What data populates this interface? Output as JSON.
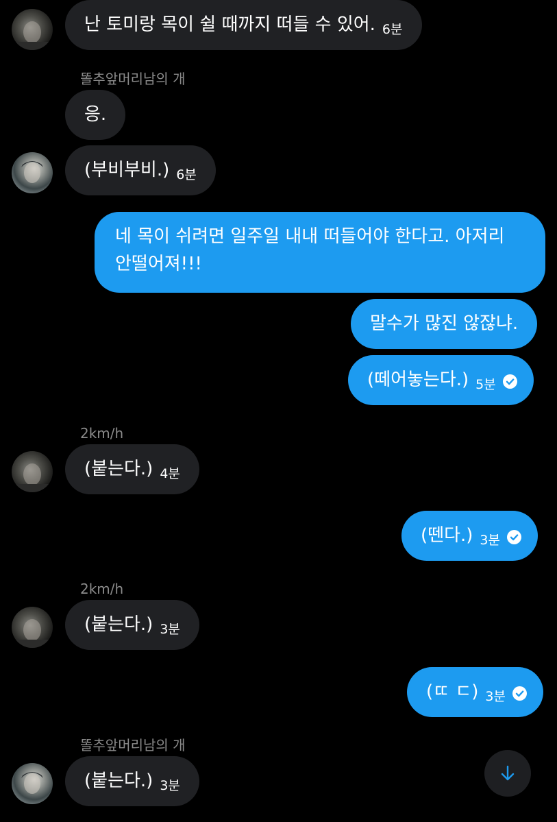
{
  "messages": [
    {
      "text": "난 토미랑 목이 쉴 때까지 떠들 수 있어.",
      "time": "6분"
    },
    {
      "sender": "똘추앞머리남의 개",
      "text": "응."
    },
    {
      "text": "(부비부비.)",
      "time": "6분"
    },
    {
      "text_line1": "네 목이 쉬려면 일주일 내내 떠들어야 한다고. 아저리",
      "text_line2": "안떨어져!!!"
    },
    {
      "text": "말수가 많진 않잖냐."
    },
    {
      "text": "(떼어놓는다.)",
      "time": "5분"
    },
    {
      "sender": "2km/h",
      "text": "(붙는다.)",
      "time": "4분"
    },
    {
      "text": "(뗀다.)",
      "time": "3분"
    },
    {
      "sender": "2km/h",
      "text": "(붙는다.)",
      "time": "3분"
    },
    {
      "text": "(ㄸ ㄷ)",
      "time": "3분"
    },
    {
      "sender": "똘추앞머리남의 개",
      "text": "(붙는다.)",
      "time": "3분"
    }
  ],
  "colors": {
    "sent_bubble": "#1d9bf0",
    "received_bubble": "#202124",
    "background": "#000000"
  },
  "icons": {
    "read_receipt": "check-circle-icon",
    "scroll_down": "arrow-down-icon"
  }
}
